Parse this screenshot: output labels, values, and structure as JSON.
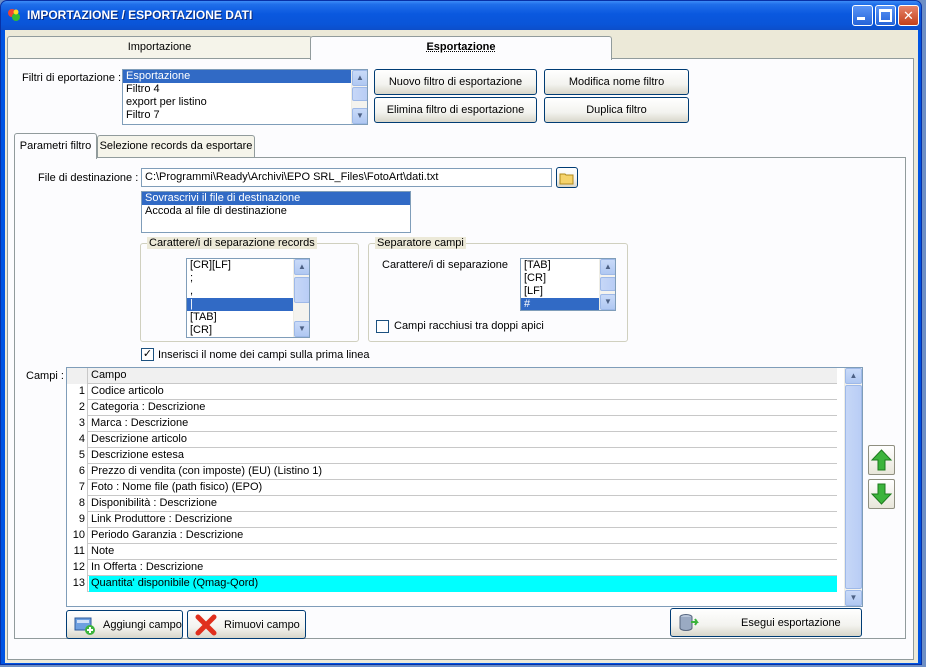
{
  "window": {
    "title": "IMPORTAZIONE / ESPORTAZIONE DATI"
  },
  "main_tabs": [
    {
      "label": "Importazione"
    },
    {
      "label": "Esportazione"
    }
  ],
  "filters": {
    "label": "Filtri di eportazione :",
    "items": [
      "Esportazione",
      "Filtro 4",
      "export per listino",
      "Filtro 7"
    ],
    "selected": "Esportazione",
    "buttons": {
      "new": "Nuovo filtro di esportazione",
      "rename": "Modifica nome filtro",
      "delete": "Elimina filtro di esportazione",
      "duplicate": "Duplica filtro"
    }
  },
  "sub_tabs": [
    {
      "label": "Parametri filtro"
    },
    {
      "label": "Selezione records da esportare"
    }
  ],
  "destination": {
    "label": "File di destinazione :",
    "value": "C:\\Programmi\\Ready\\Archivi\\EPO SRL_Files\\FotoArt\\dati.txt",
    "modes": [
      "Sovrascrivi il file di destinazione",
      "Accoda al file di destinazione"
    ],
    "selected_mode": "Sovrascrivi il file di destinazione"
  },
  "record_separator": {
    "group_label": "Carattere/i di separazione records",
    "items": [
      "[CR][LF]",
      ";",
      ",",
      "|",
      "[TAB]",
      "[CR]"
    ],
    "selected": "|"
  },
  "field_separator": {
    "group_label": "Separatore campi",
    "label": "Carattere/i di separazione",
    "items": [
      "[TAB]",
      "[CR]",
      "[LF]",
      "#"
    ],
    "selected": "#",
    "quote_checkbox": {
      "label": "Campi racchiusi tra doppi apici",
      "checked": false
    }
  },
  "header_checkbox": {
    "label": "Inserisci il nome dei campi sulla prima linea",
    "checked": true
  },
  "fields": {
    "label": "Campi :",
    "column_header": "Campo",
    "rows": [
      {
        "n": "1",
        "name": "Codice articolo"
      },
      {
        "n": "2",
        "name": "Categoria : Descrizione"
      },
      {
        "n": "3",
        "name": "Marca : Descrizione"
      },
      {
        "n": "4",
        "name": "Descrizione articolo"
      },
      {
        "n": "5",
        "name": "Descrizione estesa"
      },
      {
        "n": "6",
        "name": "Prezzo di vendita (con imposte) (EU) (Listino 1)"
      },
      {
        "n": "7",
        "name": "Foto : Nome file (path fisico) (EPO)"
      },
      {
        "n": "8",
        "name": "Disponibilità : Descrizione"
      },
      {
        "n": "9",
        "name": "Link Produttore : Descrizione"
      },
      {
        "n": "10",
        "name": "Periodo Garanzia : Descrizione"
      },
      {
        "n": "11",
        "name": "Note"
      },
      {
        "n": "12",
        "name": "In Offerta : Descrizione"
      },
      {
        "n": "13",
        "name": "Quantita' disponibile (Qmag-Qord)"
      }
    ],
    "highlight_color": "#00ffff"
  },
  "bottom_buttons": {
    "add": "Aggiungi campo",
    "remove": "Rimuovi campo",
    "run": "Esegui esportazione"
  }
}
